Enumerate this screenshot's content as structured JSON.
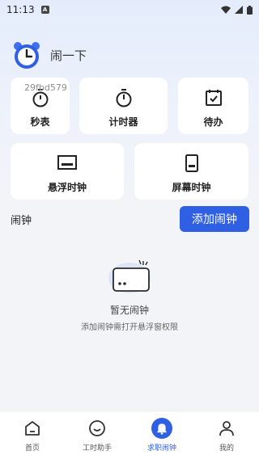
{
  "status_bar": {
    "time": "11:13",
    "notification_letter": "A"
  },
  "header": {
    "app_name": "闹一下"
  },
  "watermark": "29fbd579",
  "tools": {
    "stopwatch": "秒表",
    "timer": "计时器",
    "todo": "待办",
    "floating_clock": "悬浮时钟",
    "screen_clock": "屏幕时钟"
  },
  "alarm_section": {
    "title": "闹钟",
    "add_button": "添加闹钟"
  },
  "empty_state": {
    "title": "暂无闹钟",
    "description": "添加闹钟需打开悬浮窗权限"
  },
  "tabbar": {
    "active": "求职闹钟",
    "items": [
      {
        "label": "首页",
        "icon": "home-icon"
      },
      {
        "label": "工时助手",
        "icon": "smile-icon"
      },
      {
        "label": "求职闹钟",
        "icon": "bell-icon"
      },
      {
        "label": "我的",
        "icon": "user-icon"
      }
    ]
  },
  "colors": {
    "accent": "#2f5fe3",
    "background": "#f3f4f8"
  }
}
